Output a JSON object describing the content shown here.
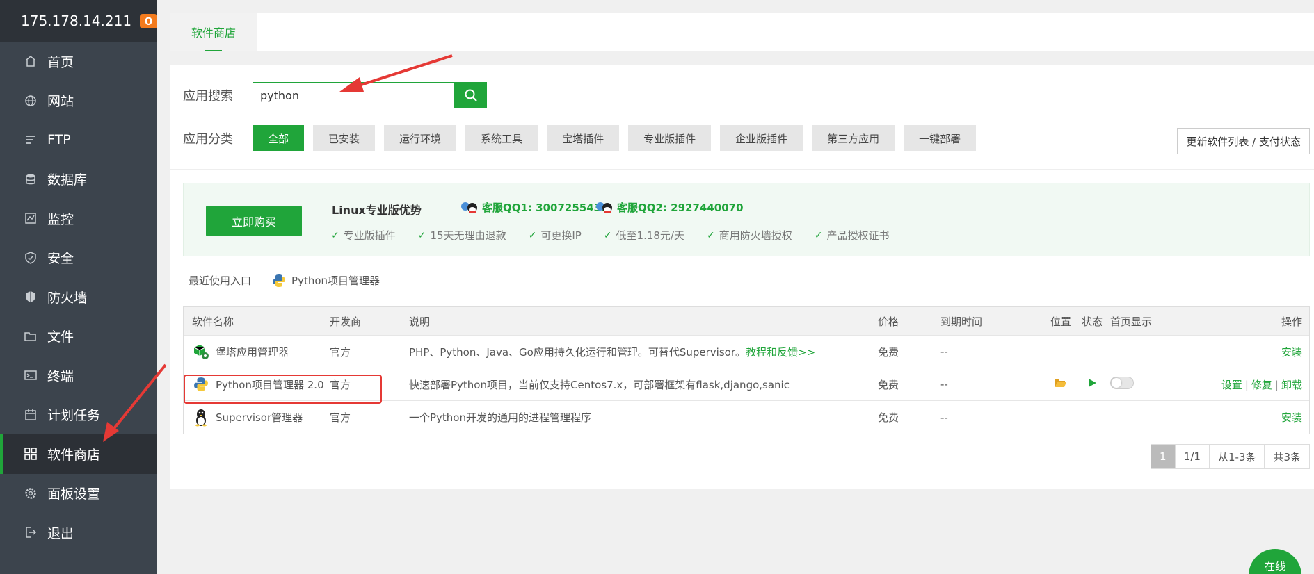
{
  "server": {
    "ip": "175.178.14.211",
    "badge": "0"
  },
  "sidebar": {
    "items": [
      {
        "label": "首页",
        "icon": "home-icon"
      },
      {
        "label": "网站",
        "icon": "globe-icon"
      },
      {
        "label": "FTP",
        "icon": "ftp-icon"
      },
      {
        "label": "数据库",
        "icon": "database-icon"
      },
      {
        "label": "监控",
        "icon": "monitor-icon"
      },
      {
        "label": "安全",
        "icon": "shield-icon"
      },
      {
        "label": "防火墙",
        "icon": "firewall-icon"
      },
      {
        "label": "文件",
        "icon": "folder-icon"
      },
      {
        "label": "终端",
        "icon": "terminal-icon"
      },
      {
        "label": "计划任务",
        "icon": "calendar-icon"
      },
      {
        "label": "软件商店",
        "icon": "grid-icon",
        "active": true
      },
      {
        "label": "面板设置",
        "icon": "gear-icon"
      },
      {
        "label": "退出",
        "icon": "logout-icon"
      }
    ]
  },
  "tab": {
    "label": "软件商店"
  },
  "search": {
    "label": "应用搜索",
    "value": "python"
  },
  "category": {
    "label": "应用分类",
    "items": [
      "全部",
      "已安装",
      "运行环境",
      "系统工具",
      "宝塔插件",
      "专业版插件",
      "企业版插件",
      "第三方应用",
      "一键部署"
    ],
    "active": "全部"
  },
  "refresh_button": "更新软件列表 / 支付状态",
  "promo": {
    "buy_label": "立即购买",
    "title": "Linux专业版优势",
    "qq1": "客服QQ1: 3007255432",
    "qq2": "客服QQ2: 2927440070",
    "features": [
      "专业版插件",
      "15天无理由退款",
      "可更换IP",
      "低至1.18元/天",
      "商用防火墙授权",
      "产品授权证书"
    ]
  },
  "recent": {
    "label": "最近使用入口",
    "item": "Python项目管理器"
  },
  "table": {
    "headers": {
      "name": "软件名称",
      "dev": "开发商",
      "desc": "说明",
      "price": "价格",
      "expire": "到期时间",
      "location": "位置",
      "status": "状态",
      "home": "首页显示",
      "op": "操作"
    },
    "rows": [
      {
        "name": "堡塔应用管理器",
        "dev": "官方",
        "desc": "PHP、Python、Java、Go应用持久化运行和管理。可替代Supervisor。",
        "desc_link": "教程和反馈>>",
        "price": "免费",
        "expire": "--",
        "op": "安装"
      },
      {
        "name": "Python项目管理器 2.0",
        "dev": "官方",
        "desc": "快速部署Python项目，当前仅支持Centos7.x，可部署框架有flask,django,sanic",
        "price": "免费",
        "expire": "--",
        "op_set": "设置",
        "op_fix": "修复",
        "op_uninstall": "卸载"
      },
      {
        "name": "Supervisor管理器",
        "dev": "官方",
        "desc": "一个Python开发的通用的进程管理程序",
        "price": "免费",
        "expire": "--",
        "op": "安装"
      }
    ]
  },
  "pager": {
    "current": "1",
    "pages": "1/1",
    "range": "从1-3条",
    "total": "共3条"
  },
  "online": "在线",
  "colors": {
    "accent": "#20a53a",
    "sidebar": "#3c444d",
    "annotation": "#e53935"
  }
}
